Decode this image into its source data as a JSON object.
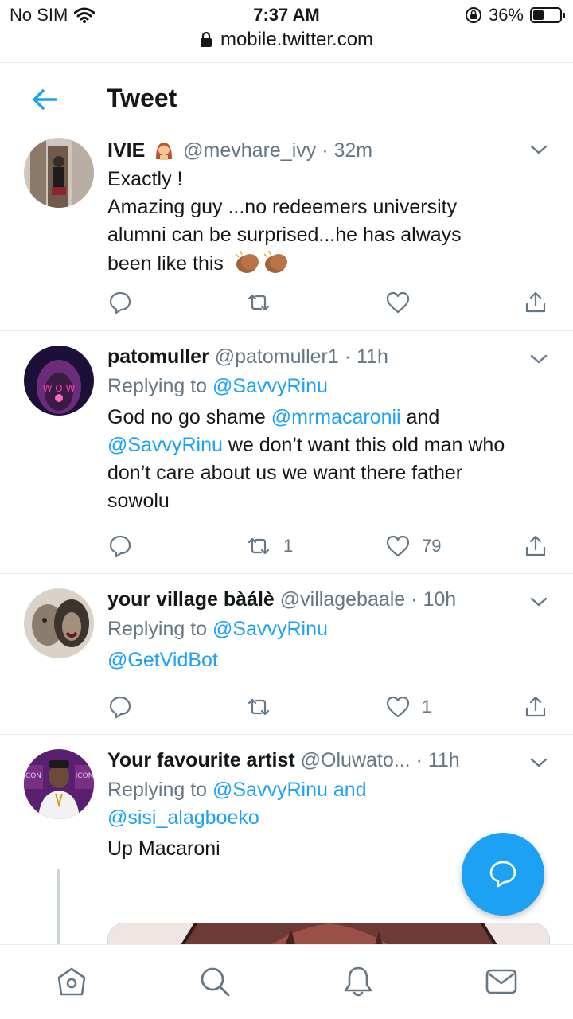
{
  "status_bar": {
    "carrier": "No SIM",
    "time": "7:37 AM",
    "battery": "36%",
    "battery_level": 0.36
  },
  "browser": {
    "url": "mobile.twitter.com"
  },
  "header": {
    "title": "Tweet"
  },
  "tweets": [
    {
      "name": "IVIE",
      "handle": "@mevhare_ivy",
      "sep": "·",
      "time": "32m",
      "lines": [
        "Exactly !",
        "Amazing guy ...no redeemers university",
        "alumni can be surprised...he has always",
        "been like this"
      ],
      "retweets": "",
      "likes": ""
    },
    {
      "name": "patomuller",
      "handle": "@patomuller1",
      "sep": "·",
      "time": "11h",
      "replying_prefix": "Replying to",
      "replying_to": "@SavvyRinu",
      "text_parts": {
        "p1": "God no go shame ",
        "m1": "@mrmacaronii",
        "p2": " and",
        "m2": "@SavvyRinu",
        "p3": " we don’t want this old man who",
        "p4": "don’t care about us we want there father",
        "p5": "sowolu"
      },
      "retweets": "1",
      "likes": "79"
    },
    {
      "name": "your village bàálè",
      "handle": "@villagebaale",
      "sep": "·",
      "time": "10h",
      "replying_prefix": "Replying to",
      "replying_to": "@SavvyRinu",
      "text": "@GetVidBot",
      "retweets": "",
      "likes": "1"
    },
    {
      "name": "Your favourite artist",
      "handle": "@Oluwato...",
      "sep": "·",
      "time": "11h",
      "replying_prefix": "Replying to",
      "replying_to": "@SavvyRinu",
      "replying_and": " and",
      "replying_to_2": "@sisi_alagboeko",
      "text": "Up Macaroni"
    }
  ],
  "icons": {
    "back": "arrow-left-icon",
    "reply": "reply-icon",
    "retweet": "retweet-icon",
    "like": "heart-icon",
    "share": "share-icon",
    "compose": "compose-reply-icon",
    "nav": [
      "home-icon",
      "search-icon",
      "notifications-icon",
      "messages-icon"
    ]
  },
  "colors": {
    "accent": "#1da1f2",
    "muted": "#657786",
    "border": "#e6ecf0"
  }
}
